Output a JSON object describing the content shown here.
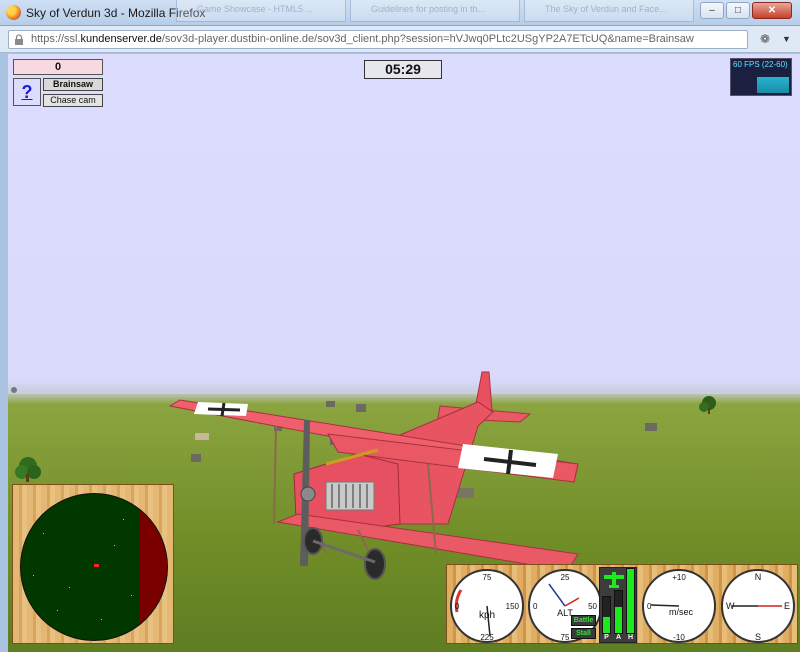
{
  "window": {
    "title": "Sky of Verdun 3d - Mozilla Firefox",
    "background_tabs": [
      "Game Showcase - HTML5 ...",
      "Guidelines for posting in th...",
      "The Sky of Verdun and Face..."
    ],
    "controls": [
      "minimize",
      "maximize",
      "close"
    ]
  },
  "urlbar": {
    "url_prefix": "https://ssl.",
    "url_domain": "kundenserver.de",
    "url_rest": "/sov3d-player.dustbin-online.de/sov3d_client.php?session=hVJwq0PLtc2USgYP2A7ETcUQ&name=Brainsaw"
  },
  "hud": {
    "score": "0",
    "help_label": "?",
    "player_name": "Brainsaw",
    "camera_label": "Chase cam",
    "timer": "05:29",
    "fps": "60 FPS (22-60)"
  },
  "instruments": {
    "speed": {
      "unit": "kph",
      "top": "75",
      "left": "0",
      "right": "150",
      "bottom": "225"
    },
    "altimeter": {
      "label": "ALT",
      "top": "25",
      "left": "0",
      "right": "50",
      "bottom": "75"
    },
    "bars": {
      "p_label": "P",
      "a_label": "A",
      "h_label": "H",
      "p_level": 0.45,
      "a_level": 0.62,
      "h_level": 1.0
    },
    "battle_label": "Battle",
    "stall_label": "Stall",
    "vario": {
      "unit": "m/sec",
      "top": "+10",
      "left": "0",
      "bottom": "-10"
    },
    "compass": {
      "n": "N",
      "e": "E",
      "s": "S",
      "w": "W"
    }
  },
  "colors": {
    "sky": "#dcdcff",
    "grass": "#7f9a2f",
    "plane": "#e84d5a",
    "radar_bg": "#003800",
    "radar_danger": "#7a0000",
    "bar_fill": "#1ee81e"
  }
}
